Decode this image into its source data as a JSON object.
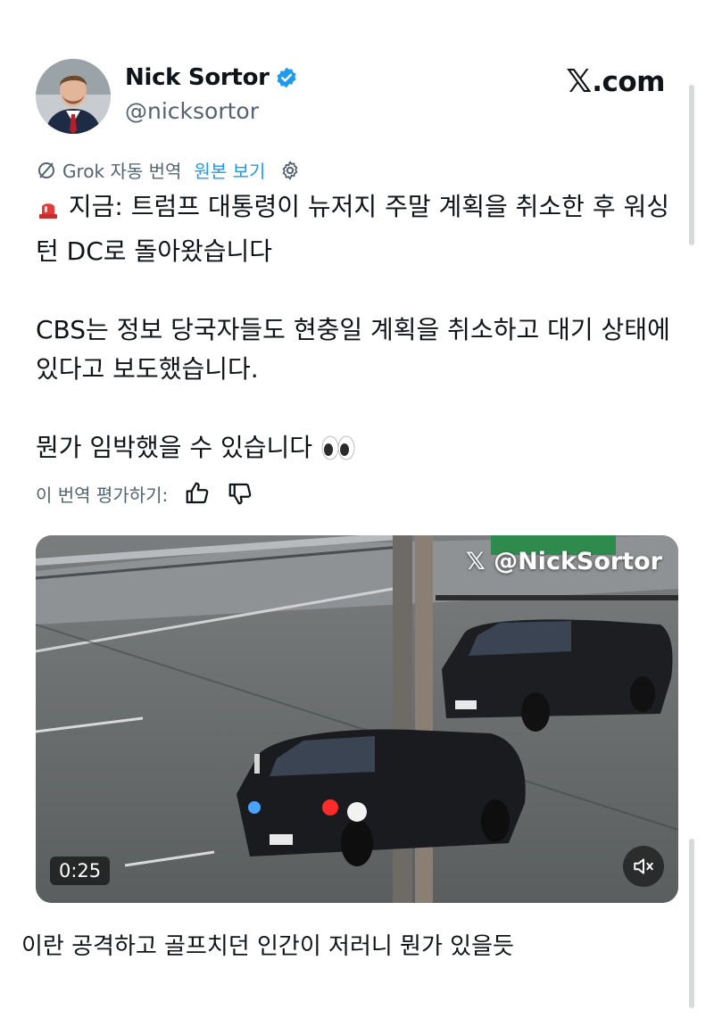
{
  "author": {
    "name": "Nick Sortor",
    "handle": "@nicksortor",
    "verified_color": "#1d9bf0"
  },
  "brand": {
    "logo_mark": "𝕏",
    "logo_text": ".com"
  },
  "translation": {
    "label": "Grok 자동 번역",
    "view_original": "원본 보기",
    "rate_label": "이 번역 평가하기:"
  },
  "tweet": {
    "line1_emoji": "🚨",
    "line1": "지금: 트럼프 대통령이 뉴저지 주말 계획을 취소한 후 워싱턴 DC로 돌아왔습니다",
    "line2": "CBS는 정보 당국자들도 현충일 계획을 취소하고 대기 상태에 있다고 보도했습니다.",
    "line3": "뭔가 임박했을 수 있습니다",
    "line3_emoji": "👀"
  },
  "video": {
    "watermark": "𝕏 @NickSortor",
    "duration": "0:25"
  },
  "comment": "이란 공격하고 골프치던 인간이 저러니 뭔가 있을듯"
}
